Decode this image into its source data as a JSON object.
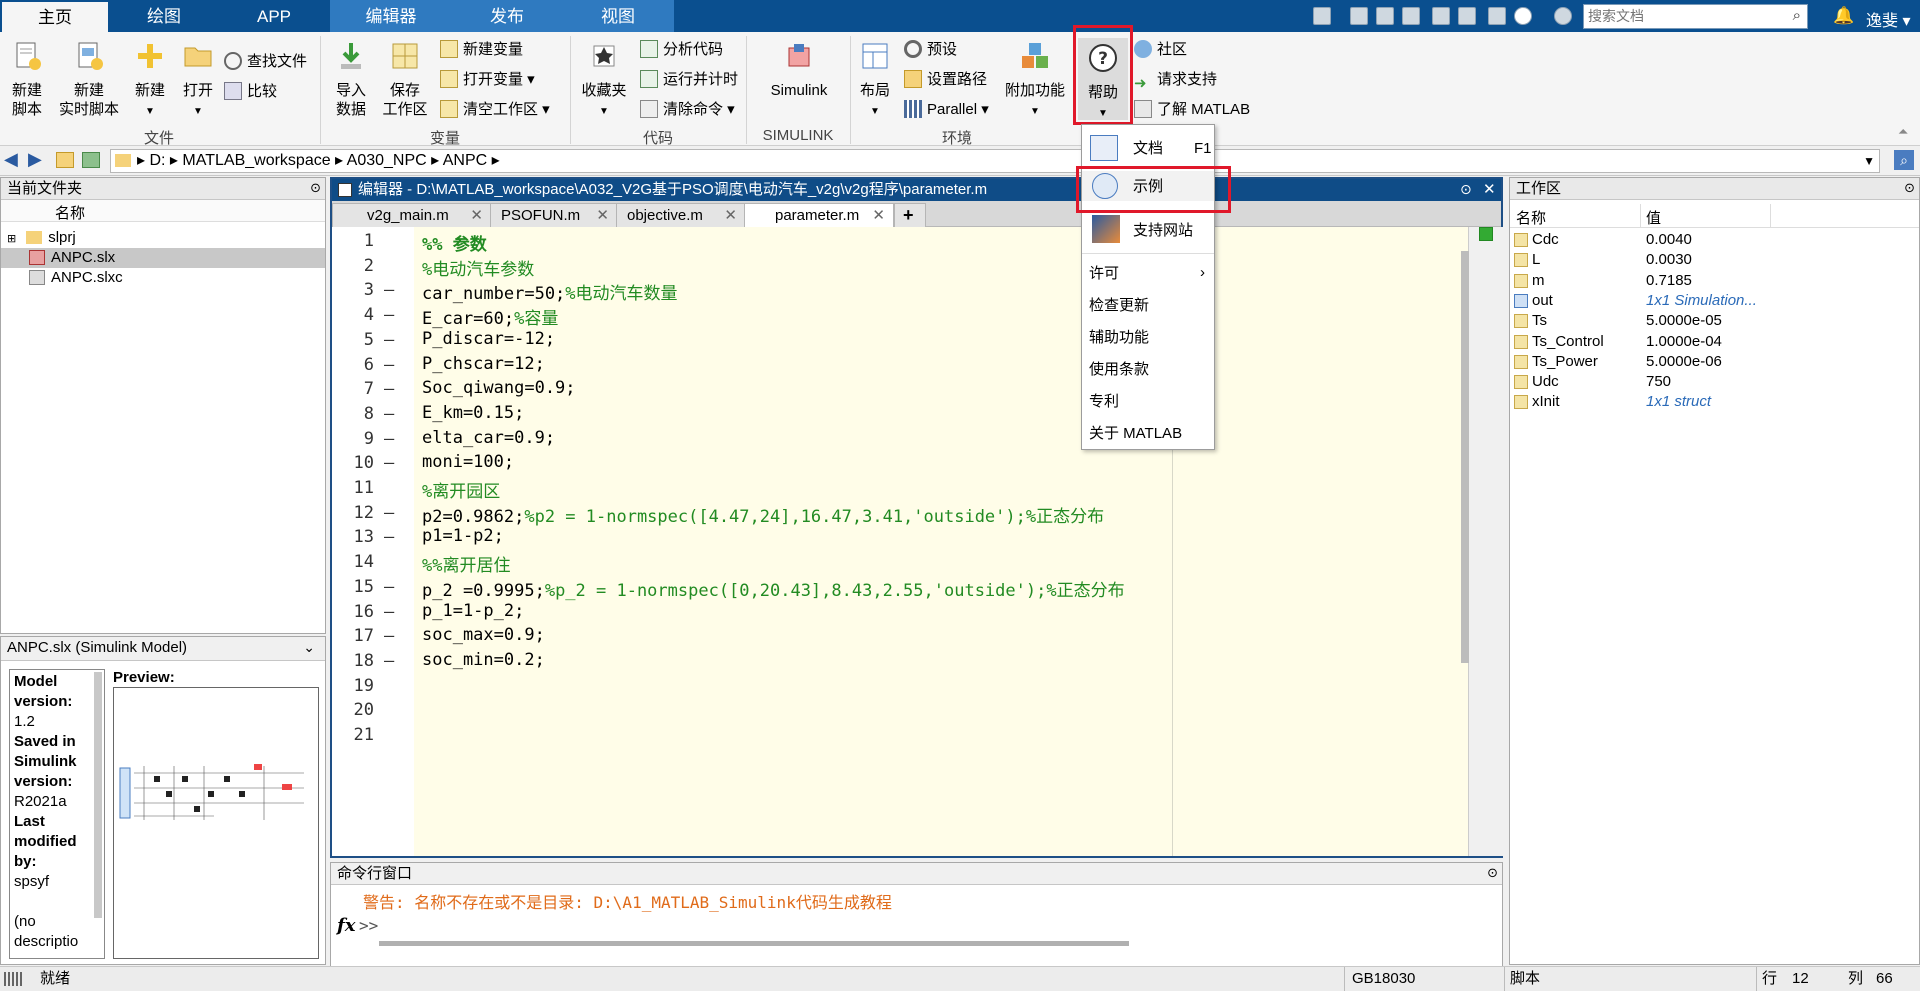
{
  "tabs": {
    "home": "主页",
    "plot": "绘图",
    "app": "APP",
    "editor": "编辑器",
    "publish": "发布",
    "view": "视图"
  },
  "search": {
    "placeholder": "搜索文档"
  },
  "user": "逸斐",
  "ribbon": {
    "new_script": "新建\n脚本",
    "new_live": "新建\n实时脚本",
    "new": "新建",
    "open": "打开",
    "find_files": "查找文件",
    "compare": "比较",
    "group_file": "文件",
    "import": "导入\n数据",
    "save_ws": "保存\n工作区",
    "new_var": "新建变量",
    "open_var": "打开变量",
    "clear_ws": "清空工作区",
    "group_var": "变量",
    "favorites": "收藏夹",
    "analyze": "分析代码",
    "run_time": "运行并计时",
    "clear_cmd": "清除命令",
    "group_code": "代码",
    "simulink": "Simulink",
    "group_simulink": "SIMULINK",
    "layout": "布局",
    "prefs": "预设",
    "set_path": "设置路径",
    "parallel": "Parallel",
    "group_env": "环境",
    "addons": "附加功能",
    "help": "帮助",
    "community": "社区",
    "support": "请求支持",
    "learn": "了解 MATLAB"
  },
  "address": {
    "drive": "D:",
    "seg1": "MATLAB_workspace",
    "seg2": "A030_NPC",
    "seg3": "ANPC"
  },
  "current_folder": {
    "title": "当前文件夹",
    "col": "名称",
    "items": [
      "slprj",
      "ANPC.slx",
      "ANPC.slxc"
    ]
  },
  "details": {
    "title": "ANPC.slx  (Simulink Model)",
    "preview": "Preview:",
    "lines": [
      "Model",
      "version:",
      "1.2",
      "Saved in",
      "Simulink",
      "version:",
      "R2021a",
      "Last",
      "modified",
      "by:",
      "spsyf",
      "",
      "(no",
      "descriptio"
    ]
  },
  "editor": {
    "title": "编辑器 - D:\\MATLAB_workspace\\A032_V2G基于PSO调度\\电动汽车_v2g\\v2g程序\\parameter.m",
    "tabs": [
      "v2g_main.m",
      "PSOFUN.m",
      "objective.m",
      "parameter.m"
    ],
    "lines": [
      {
        "code": "%% 参数",
        "type": "section"
      },
      {
        "code": "%电动汽车参数",
        "type": "comment"
      },
      {
        "code": "car_number=50;",
        "comment": "%电动汽车数量"
      },
      {
        "code": "E_car=60;",
        "comment": "%容量"
      },
      {
        "code": "P_discar=-12;"
      },
      {
        "code": "P_chscar=12;"
      },
      {
        "code": "Soc_qiwang=0.9;"
      },
      {
        "code": "E_km=0.15;"
      },
      {
        "code": "elta_car=0.9;"
      },
      {
        "code": "moni=100;"
      },
      {
        "code": "%离开园区",
        "type": "comment"
      },
      {
        "code": "p2=0.9862;",
        "comment": "%p2 = 1-normspec([4.47,24],16.47,3.41,'outside');%正态分布"
      },
      {
        "code": "p1=1-p2;"
      },
      {
        "code": "%%离开居住",
        "type": "comment"
      },
      {
        "code": "p_2 =0.9995;",
        "comment": "%p_2 = 1-normspec([0,20.43],8.43,2.55,'outside');%正态分布"
      },
      {
        "code": "p_1=1-p_2;"
      },
      {
        "code": "soc_max=0.9;"
      },
      {
        "code": "soc_min=0.2;"
      },
      {
        "code": ""
      },
      {
        "code": ""
      },
      {
        "code": ""
      }
    ]
  },
  "menu": {
    "doc": "文档",
    "doc_key": "F1",
    "examples": "示例",
    "support_site": "支持网站",
    "license": "许可",
    "check_updates": "检查更新",
    "accessibility": "辅助功能",
    "terms": "使用条款",
    "patents": "专利",
    "about": "关于 MATLAB"
  },
  "workspace": {
    "title": "工作区",
    "col_name": "名称",
    "col_value": "值",
    "vars": [
      [
        "Cdc",
        "0.0040"
      ],
      [
        "L",
        "0.0030"
      ],
      [
        "m",
        "0.7185"
      ],
      [
        "out",
        "1x1 Simulation..."
      ],
      [
        "Ts",
        "5.0000e-05"
      ],
      [
        "Ts_Control",
        "1.0000e-04"
      ],
      [
        "Ts_Power",
        "5.0000e-06"
      ],
      [
        "Udc",
        "750"
      ],
      [
        "xInit",
        "1x1 struct"
      ]
    ]
  },
  "command": {
    "title": "命令行窗口",
    "warning": "警告: 名称不存在或不是目录: D:\\A1_MATLAB_Simulink代码生成教程",
    "prompt": ">>",
    "fx": "fx"
  },
  "status": {
    "ready": "就绪",
    "encoding": "GB18030",
    "type": "脚本",
    "row_label": "行",
    "row": "12",
    "col_label": "列",
    "col": "66"
  },
  "colors": {
    "tabbar": "#0a4f8f",
    "editor_tab": "#2f7ac0",
    "code_bg": "#fffde8",
    "comment": "#228b22",
    "warning": "#e06b1a",
    "highlight": "#e0182a"
  }
}
